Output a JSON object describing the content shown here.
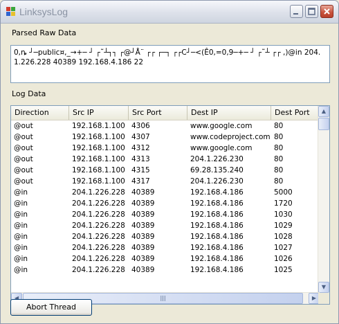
{
  "window": {
    "title": "LinksysLog"
  },
  "raw_section": {
    "label": "Parsed Raw Data",
    "text": "0,ȵ ┘─public¤,_→+─ ┘ ┌˜┴┐┐ ┌@┘Å¨ ┌┌ ┌─┐ ┌┌C┘─<(Ê0,=0,9─+─ ┘ ┌˜┴ ┌┌ ,)@in 204.1.226.228 40389 192.168.4.186 22"
  },
  "log_section": {
    "label": "Log Data",
    "columns": [
      "Direction",
      "Src IP",
      "Src Port",
      "Dest IP",
      "Dest Port"
    ],
    "rows": [
      [
        "@out",
        "192.168.1.100",
        "4306",
        "www.google.com",
        "80"
      ],
      [
        "@out",
        "192.168.1.100",
        "4307",
        "www.codeproject.com",
        "80"
      ],
      [
        "@out",
        "192.168.1.100",
        "4312",
        "www.google.com",
        "80"
      ],
      [
        "@out",
        "192.168.1.100",
        "4313",
        "204.1.226.230",
        "80"
      ],
      [
        "@out",
        "192.168.1.100",
        "4315",
        "69.28.135.240",
        "80"
      ],
      [
        "@out",
        "192.168.1.100",
        "4317",
        "204.1.226.230",
        "80"
      ],
      [
        "@in",
        "204.1.226.228",
        "40389",
        "192.168.4.186",
        "5000"
      ],
      [
        "@in",
        "204.1.226.228",
        "40389",
        "192.168.4.186",
        "1720"
      ],
      [
        "@in",
        "204.1.226.228",
        "40389",
        "192.168.4.186",
        "1030"
      ],
      [
        "@in",
        "204.1.226.228",
        "40389",
        "192.168.4.186",
        "1029"
      ],
      [
        "@in",
        "204.1.226.228",
        "40389",
        "192.168.4.186",
        "1028"
      ],
      [
        "@in",
        "204.1.226.228",
        "40389",
        "192.168.4.186",
        "1027"
      ],
      [
        "@in",
        "204.1.226.228",
        "40389",
        "192.168.4.186",
        "1026"
      ],
      [
        "@in",
        "204.1.226.228",
        "40389",
        "192.168.4.186",
        "1025"
      ]
    ]
  },
  "buttons": {
    "abort": "Abort Thread"
  }
}
